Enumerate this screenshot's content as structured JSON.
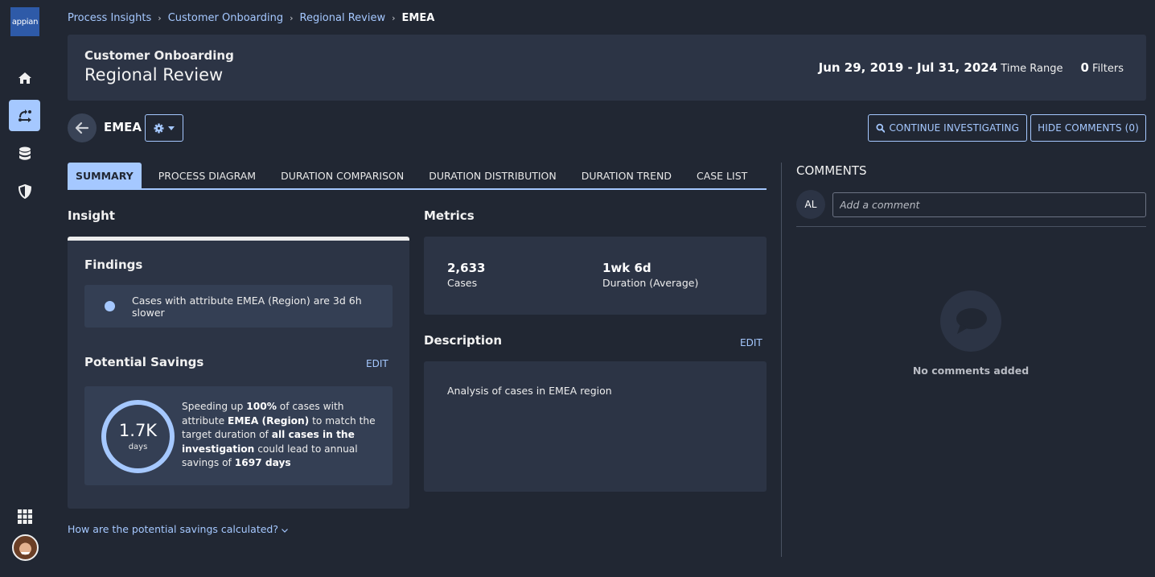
{
  "app": {
    "logo_text": "appian"
  },
  "nav": {
    "items": [
      {
        "name": "home",
        "icon": "home-icon",
        "active": false
      },
      {
        "name": "process-insights",
        "icon": "process-flow-icon",
        "active": true
      },
      {
        "name": "data",
        "icon": "database-icon",
        "active": false
      },
      {
        "name": "security",
        "icon": "shield-icon",
        "active": false
      }
    ],
    "apps_icon": "grid-icon",
    "user_avatar": "user-avatar"
  },
  "breadcrumb": {
    "items": [
      "Process Insights",
      "Customer Onboarding",
      "Regional Review"
    ],
    "current": "EMEA",
    "separator": "›"
  },
  "header": {
    "subtitle": "Customer Onboarding",
    "title": "Regional Review",
    "time_range_value": "Jun 29, 2019 - Jul 31, 2024",
    "time_range_label": "Time Range",
    "filters_count": "0",
    "filters_label": "Filters"
  },
  "page": {
    "title": "EMEA",
    "continue_button": "CONTINUE INVESTIGATING",
    "hide_comments_button": "HIDE COMMENTS (0)"
  },
  "tabs": [
    {
      "label": "SUMMARY",
      "active": true
    },
    {
      "label": "PROCESS DIAGRAM",
      "active": false
    },
    {
      "label": "DURATION COMPARISON",
      "active": false
    },
    {
      "label": "DURATION DISTRIBUTION",
      "active": false
    },
    {
      "label": "DURATION TREND",
      "active": false
    },
    {
      "label": "CASE LIST",
      "active": false
    }
  ],
  "insight": {
    "heading": "Insight",
    "findings_heading": "Findings",
    "finding": "Cases with attribute EMEA (Region) are 3d 6h slower",
    "savings_heading": "Potential Savings",
    "edit_label": "EDIT",
    "savings_value": "1.7K",
    "savings_unit": "days",
    "savings_text": {
      "p1": "Speeding up ",
      "b1": "100%",
      "p2": " of cases with attribute ",
      "b2": "EMEA (Region)",
      "p3": " to match the target duration of ",
      "b3": "all cases in the investigation",
      "p4": " could lead to annual savings of ",
      "b4": "1697 days"
    },
    "how_link": "How are the potential savings calculated?"
  },
  "metrics": {
    "heading": "Metrics",
    "items": [
      {
        "value": "2,633",
        "label": "Cases"
      },
      {
        "value": "1wk 6d",
        "label": "Duration (Average)"
      }
    ]
  },
  "description": {
    "heading": "Description",
    "edit_label": "EDIT",
    "text": "Analysis of cases in EMEA region"
  },
  "comments": {
    "heading": "COMMENTS",
    "user_initials": "AL",
    "placeholder": "Add a comment",
    "empty_text": "No comments added"
  },
  "colors": {
    "background": "#212733",
    "card": "#2c3445",
    "accent": "#a5c8ff",
    "logo": "#2e5aa8"
  }
}
